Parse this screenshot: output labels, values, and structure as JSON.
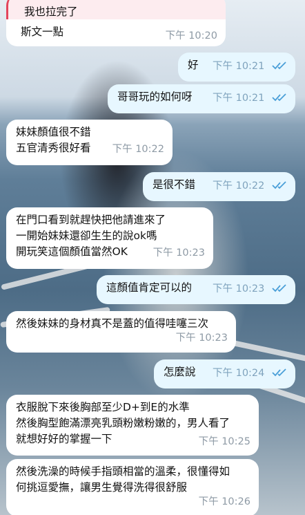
{
  "messages": [
    {
      "id": "m0",
      "direction": "incoming",
      "quote_text": "我也拉完了",
      "text": "斯文一點",
      "time": "下午 10:20"
    },
    {
      "id": "m1",
      "direction": "outgoing",
      "text": "好",
      "time": "下午 10:21",
      "status": "read"
    },
    {
      "id": "m2",
      "direction": "outgoing",
      "text": "哥哥玩的如何呀",
      "time": "下午 10:21",
      "status": "read"
    },
    {
      "id": "m3",
      "direction": "incoming",
      "lines": [
        "妹妹顏值很不錯",
        "五官清秀很好看"
      ],
      "time": "下午 10:22"
    },
    {
      "id": "m4",
      "direction": "outgoing",
      "text": "是很不錯",
      "time": "下午 10:22",
      "status": "read"
    },
    {
      "id": "m5",
      "direction": "incoming",
      "lines": [
        "在門口看到就趕快把他請進來了",
        "一開始妹妹還卻生生的說ok嗎",
        "開玩笑這個顏值當然OK"
      ],
      "time": "下午 10:23"
    },
    {
      "id": "m6",
      "direction": "outgoing",
      "text": "這顏值肯定可以的",
      "time": "下午 10:23",
      "status": "read"
    },
    {
      "id": "m7",
      "direction": "incoming",
      "lines": [
        "然後妹妹的身材真不是蓋的值得哇噻三次"
      ],
      "time": "下午 10:23"
    },
    {
      "id": "m8",
      "direction": "outgoing",
      "text": "怎麼說",
      "time": "下午 10:24",
      "status": "read"
    },
    {
      "id": "m9",
      "direction": "incoming",
      "lines": [
        "衣服脫下來後胸部至少D+到E的水準",
        "然後胸型飽滿漂亮乳頭粉嫩粉嫩的，男人看了",
        "就想好好的掌握一下"
      ],
      "time": "下午 10:25"
    },
    {
      "id": "m10",
      "direction": "incoming",
      "lines": [
        "然後洗澡的時候手指頭相當的溫柔，很懂得如",
        "何挑逗愛撫，讓男生覺得洗得很舒服"
      ],
      "time": "下午 10:26"
    }
  ],
  "colors": {
    "incoming_bubble": "#ffffff",
    "outgoing_bubble": "#e7f7ff",
    "read_ticks": "#4a9fd8",
    "quote_accent": "#e3455c"
  },
  "icons": {
    "read_status": "double-check-icon"
  }
}
